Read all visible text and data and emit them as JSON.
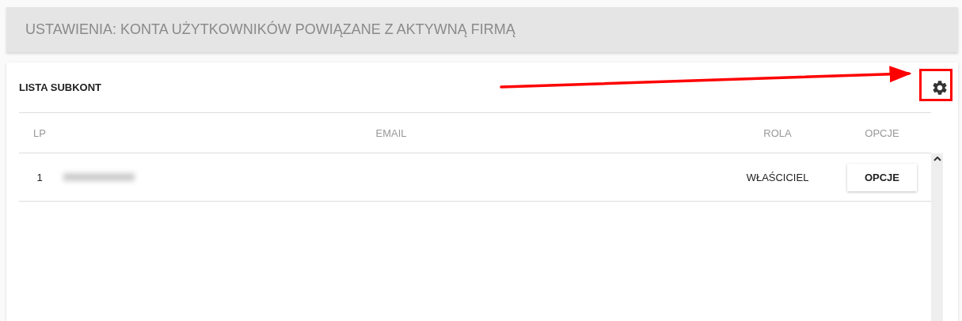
{
  "page_title": "USTAWIENIA: KONTA UŻYTKOWNIKÓW POWIĄZANE Z AKTYWNĄ FIRMĄ",
  "panel": {
    "title": "LISTA SUBKONT",
    "table": {
      "columns": [
        "LP",
        "EMAIL",
        "ROLA",
        "OPCJE"
      ],
      "rows": [
        {
          "lp": "1",
          "email_redacted": true,
          "role": "WŁAŚCICIEL",
          "action": "OPCJE"
        }
      ]
    }
  }
}
